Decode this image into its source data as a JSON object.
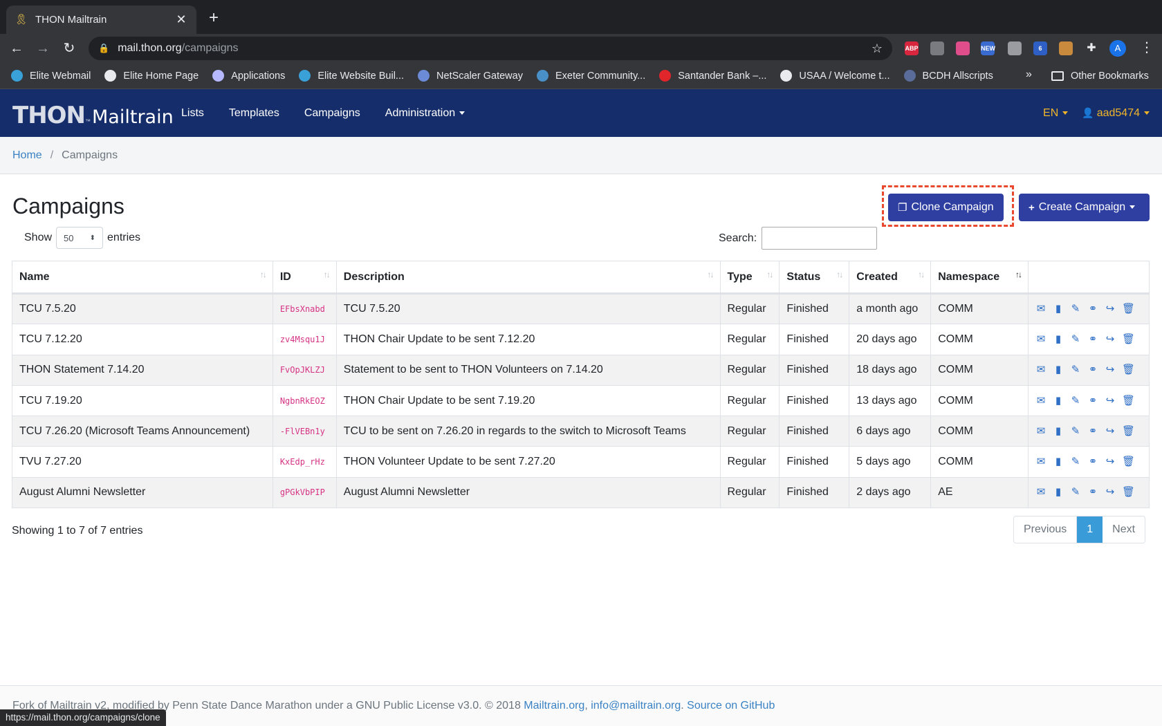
{
  "browser": {
    "tab_title": "THON Mailtrain",
    "url_host": "mail.thon.org",
    "url_path": "/campaigns",
    "status_url": "https://mail.thon.org/campaigns/clone",
    "extensions": [
      {
        "label": "ABP",
        "color": "#d7263d"
      },
      {
        "label": "",
        "color": "#7a7b80"
      },
      {
        "label": "",
        "color": "#e04d8b"
      },
      {
        "label": "NEW",
        "color": "#3a6bd0"
      },
      {
        "label": "",
        "color": "#9a9ca1"
      },
      {
        "label": "6",
        "color": "#2d5fc4"
      },
      {
        "label": "",
        "color": "#c98a3d"
      },
      {
        "label": "",
        "color": "#e8eaed"
      }
    ],
    "profile_initial": "A",
    "bookmarks": [
      {
        "label": "Elite Webmail",
        "color": "#3aa0d8"
      },
      {
        "label": "Elite Home Page",
        "color": "#e8eaed"
      },
      {
        "label": "Applications",
        "color": "#b6b9ff"
      },
      {
        "label": "Elite Website Buil...",
        "color": "#3aa0d8"
      },
      {
        "label": "NetScaler Gateway",
        "color": "#6c8bd6"
      },
      {
        "label": "Exeter Community...",
        "color": "#4a90c8"
      },
      {
        "label": "Santander Bank –...",
        "color": "#e0262b"
      },
      {
        "label": "USAA / Welcome t...",
        "color": "#e8eaed"
      },
      {
        "label": "BCDH Allscripts",
        "color": "#5a6d9a"
      }
    ],
    "bookmarks_more": "»",
    "other_bookmarks": "Other Bookmarks"
  },
  "nav": {
    "brand_thon": "THON",
    "brand_tm": "™",
    "brand_mailtrain": "Mailtrain",
    "links": [
      "Lists",
      "Templates",
      "Campaigns",
      "Administration"
    ],
    "lang": "EN",
    "user": "aad5474"
  },
  "breadcrumb": {
    "home": "Home",
    "separator": "/",
    "current": "Campaigns"
  },
  "page": {
    "title": "Campaigns",
    "clone_label": "Clone Campaign",
    "create_label": "Create Campaign",
    "show_label": "Show",
    "entries_value": "50",
    "entries_label": "entries",
    "search_label": "Search:",
    "search_value": ""
  },
  "table": {
    "columns": [
      "Name",
      "ID",
      "Description",
      "Type",
      "Status",
      "Created",
      "Namespace"
    ],
    "rows": [
      {
        "name": "TCU 7.5.20",
        "id": "EFbsXnabd",
        "description": "TCU 7.5.20",
        "type": "Regular",
        "status": "Finished",
        "created": "a month ago",
        "namespace": "COMM"
      },
      {
        "name": "TCU 7.12.20",
        "id": "zv4Msqu1J",
        "description": "THON Chair Update to be sent 7.12.20",
        "type": "Regular",
        "status": "Finished",
        "created": "20 days ago",
        "namespace": "COMM"
      },
      {
        "name": "THON Statement 7.14.20",
        "id": "FvOpJKLZJ",
        "description": "Statement to be sent to THON Volunteers on 7.14.20",
        "type": "Regular",
        "status": "Finished",
        "created": "18 days ago",
        "namespace": "COMM"
      },
      {
        "name": "TCU 7.19.20",
        "id": "NgbnRkEOZ",
        "description": "THON Chair Update to be sent 7.19.20",
        "type": "Regular",
        "status": "Finished",
        "created": "13 days ago",
        "namespace": "COMM"
      },
      {
        "name": "TCU 7.26.20 (Microsoft Teams Announcement)",
        "id": "-FlVEBn1y",
        "description": "TCU to be sent on 7.26.20 in regards to the switch to Microsoft Teams",
        "type": "Regular",
        "status": "Finished",
        "created": "6 days ago",
        "namespace": "COMM"
      },
      {
        "name": "TVU 7.27.20",
        "id": "KxEdp_rHz",
        "description": "THON Volunteer Update to be sent 7.27.20",
        "type": "Regular",
        "status": "Finished",
        "created": "5 days ago",
        "namespace": "COMM"
      },
      {
        "name": "August Alumni Newsletter",
        "id": "gPGkVbPIP",
        "description": "August Alumni Newsletter",
        "type": "Regular",
        "status": "Finished",
        "created": "2 days ago",
        "namespace": "AE"
      }
    ],
    "action_icons": [
      "envelope-icon",
      "stats-icon",
      "edit-icon",
      "paperclip-icon",
      "share-icon",
      "trash-icon"
    ]
  },
  "pagination": {
    "showing": "Showing 1 to 7 of 7 entries",
    "previous": "Previous",
    "current": "1",
    "next": "Next"
  },
  "footer": {
    "text": "Fork of Mailtrain v2, modified by Penn State Dance Marathon under a GNU Public License v3.0. © 2018 ",
    "link1": "Mailtrain.org",
    "sep1": ", ",
    "link2": "info@mailtrain.org",
    "sep2": ". ",
    "link3": "Source on GitHub"
  }
}
